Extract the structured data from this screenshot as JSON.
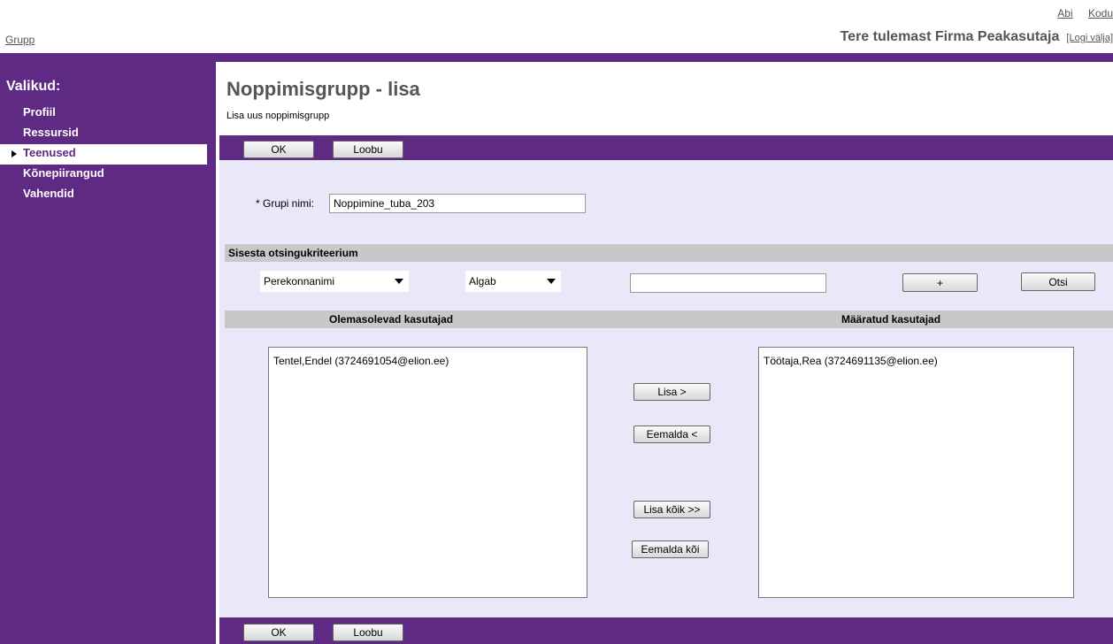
{
  "header": {
    "links": [
      "Abi",
      "Kodu"
    ],
    "breadcrumb": "Grupp",
    "welcome": "Tere tulemast Firma Peakasutaja",
    "logout": "[Logi välja]"
  },
  "sidebar": {
    "title": "Valikud:",
    "items": [
      {
        "label": "Profiil",
        "active": false
      },
      {
        "label": "Ressursid",
        "active": false
      },
      {
        "label": "Teenused",
        "active": true
      },
      {
        "label": "Kõnepiirangud",
        "active": false
      },
      {
        "label": "Vahendid",
        "active": false
      }
    ]
  },
  "page": {
    "title": "Noppimisgrupp - lisa",
    "subtitle": "Lisa uus noppimisgrupp"
  },
  "actions": {
    "ok": "OK",
    "cancel": "Loobu"
  },
  "form": {
    "group_name_label": "* Grupi nimi:",
    "group_name_value": "Noppimine_tuba_203"
  },
  "search": {
    "section_title": "Sisesta otsingukriteerium",
    "field_select": "Perekonnanimi",
    "mode_select": "Algab",
    "query_value": "",
    "plus_button": "+",
    "search_button": "Otsi"
  },
  "lists": {
    "available_header": "Olemasolevad kasutajad",
    "assigned_header": "Määratud kasutajad",
    "available_items": [
      "Tentel,Endel (3724691054@elion.ee)"
    ],
    "assigned_items": [
      "Töötaja,Rea (3724691135@elion.ee)"
    ],
    "add_button": "Lisa >",
    "remove_button": "Eemalda <",
    "add_all_button": "Lisa kõik >>",
    "remove_all_button": "Eemalda kõi"
  },
  "colors": {
    "purple": "#5e2a84",
    "content_bg": "#e8e8f8",
    "section_bg": "#c8c8c8"
  }
}
